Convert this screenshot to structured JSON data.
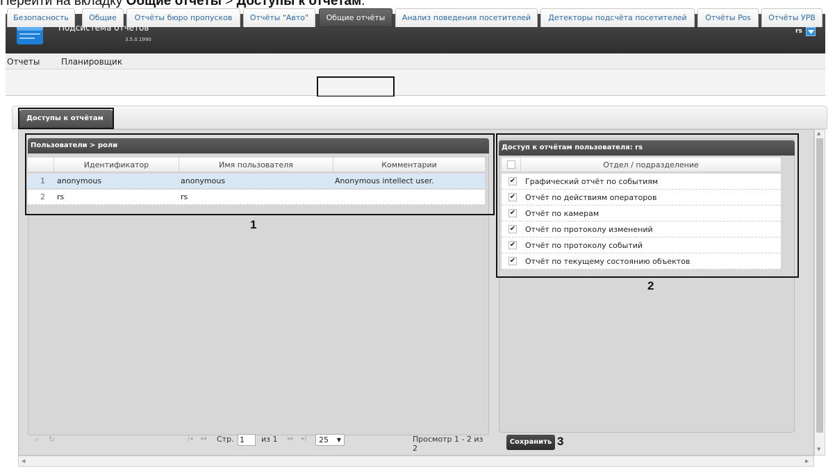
{
  "instruction": {
    "prefix": "Перейти на вкладку ",
    "bold1": "Общие отчеты",
    "sep": " > ",
    "bold2": "Доступы к отчетам",
    "suffix": "."
  },
  "app": {
    "title": "Подсистема отчётов",
    "version": "3.5.0.1990",
    "user": "rs",
    "accent_color": "#2b8fe0"
  },
  "menu": [
    "Отчеты",
    "Планировщик"
  ],
  "tabs": [
    {
      "label": "Безопасность"
    },
    {
      "label": "Общие"
    },
    {
      "label": "Отчёты бюро пропусков"
    },
    {
      "label": "Отчёты \"Авто\""
    },
    {
      "label": "Общие отчёты",
      "active": true
    },
    {
      "label": "Анализ поведения посетителей"
    },
    {
      "label": "Детекторы подсчёта посетителей"
    },
    {
      "label": "Отчёты Pos"
    },
    {
      "label": "Отчёты УРВ"
    }
  ],
  "subtab": "Доступы к отчётам",
  "users_panel": {
    "title": "Пользователи > роли",
    "columns": [
      "Идентификатор",
      "Имя пользователя",
      "Комментарии"
    ],
    "rows": [
      {
        "num": "1",
        "id": "anonymous",
        "name": "anonymous",
        "comment": "Anonymous intellect user.",
        "selected": true
      },
      {
        "num": "2",
        "id": "rs",
        "name": "rs",
        "comment": "",
        "selected": false
      }
    ]
  },
  "pager": {
    "page_label": "Стр.",
    "page_value": "1",
    "of_label": "из 1",
    "page_size": "25",
    "summary": "Просмотр 1 - 2 из 2"
  },
  "access_panel": {
    "title": "Доступ к отчётам пользователя: rs",
    "column": "Отдел / подразделение",
    "items": [
      {
        "label": "Графический отчёт по событиям",
        "checked": true
      },
      {
        "label": "Отчёт по действиям операторов",
        "checked": true
      },
      {
        "label": "Отчёт по камерам",
        "checked": true
      },
      {
        "label": "Отчёт по протоколу изменений",
        "checked": true
      },
      {
        "label": "Отчёт по протоколу событий",
        "checked": true
      },
      {
        "label": "Отчёт по текущему состоянию объектов",
        "checked": true
      }
    ]
  },
  "save_label": "Сохранить",
  "callouts": [
    "1",
    "2",
    "3"
  ]
}
